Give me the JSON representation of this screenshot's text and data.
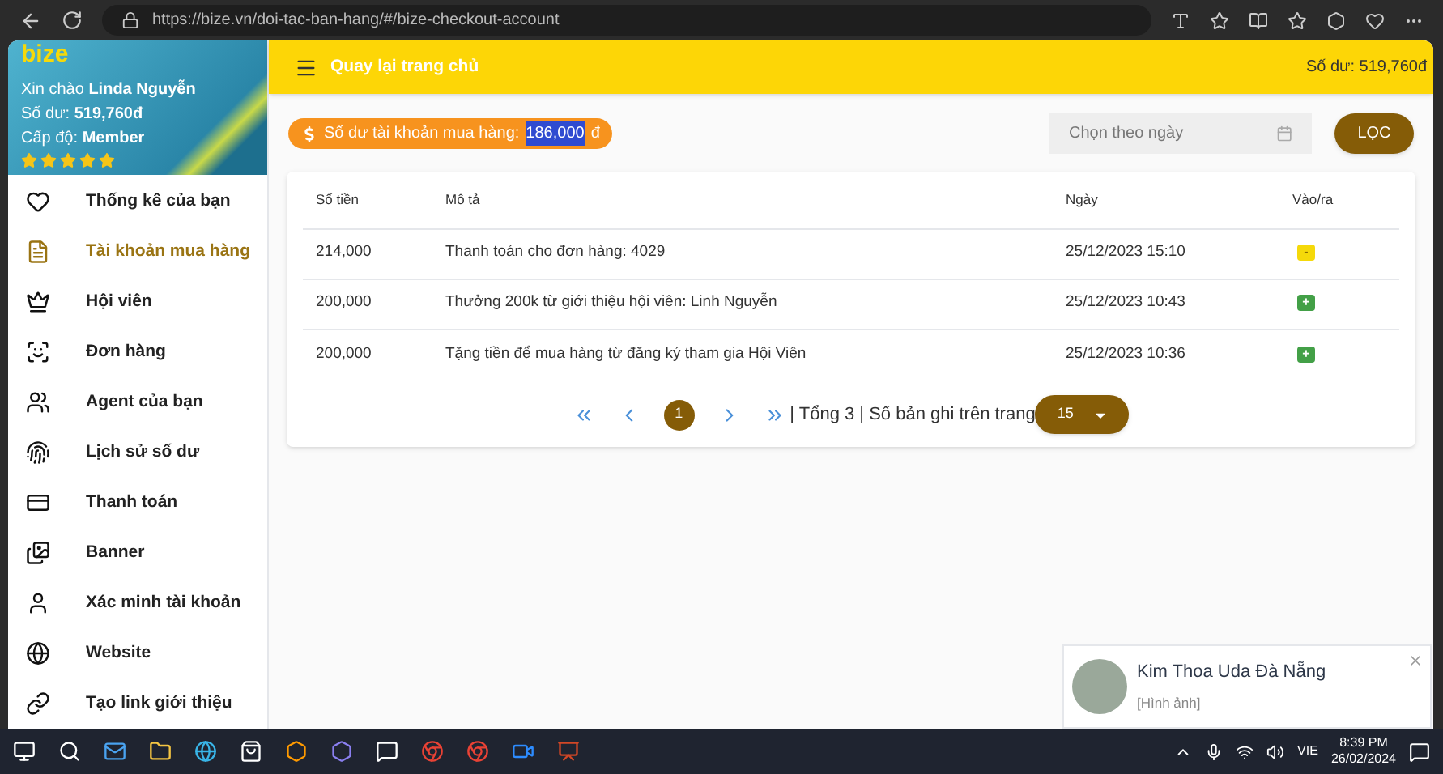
{
  "browser": {
    "url": "https://bize.vn/doi-tac-ban-hang/#/bize-checkout-account"
  },
  "sidebar": {
    "logo": "bize",
    "greeting": "Xin chào",
    "user": "Linda Nguyễn",
    "balance_label": "Số dư:",
    "balance": "519,760đ",
    "level_label": "Cấp độ:",
    "level": "Member",
    "stars": 5,
    "items": [
      {
        "label": "Thống kê của bạn",
        "selected": false
      },
      {
        "label": "Tài khoản mua hàng",
        "selected": true
      },
      {
        "label": "Hội viên",
        "selected": false
      },
      {
        "label": "Đơn hàng",
        "selected": false
      },
      {
        "label": "Agent của bạn",
        "selected": false
      },
      {
        "label": "Lịch sử số dư",
        "selected": false
      },
      {
        "label": "Thanh toán",
        "selected": false
      },
      {
        "label": "Banner",
        "selected": false
      },
      {
        "label": "Xác minh tài khoản",
        "selected": false
      },
      {
        "label": "Website",
        "selected": false
      },
      {
        "label": "Tạo link giới thiệu",
        "selected": false
      }
    ]
  },
  "header": {
    "back": "Quay lại trang chủ",
    "balance": "Số dư: 519,760đ"
  },
  "account_badge": {
    "label": "Số dư tài khoản mua hàng:",
    "amount": "186,000",
    "currency": "đ",
    "amount_selected": true
  },
  "filter": {
    "placeholder": "Chọn theo ngày",
    "button": "LỌC"
  },
  "table": {
    "columns": [
      "Số tiền",
      "Mô tả",
      "Ngày",
      "Vào/ra"
    ],
    "rows": [
      {
        "amount": "214,000",
        "description": "Thanh toán cho đơn hàng: 4029",
        "date": "25/12/2023 15:10",
        "kind": "out",
        "sign": "-"
      },
      {
        "amount": "200,000",
        "description": "Thưởng 200k từ giới thiệu hội viên: Linh Nguyễn",
        "date": "25/12/2023 10:43",
        "kind": "in",
        "sign": "+"
      },
      {
        "amount": "200,000",
        "description": "Tặng tiền để mua hàng từ đăng ký tham gia Hội Viên",
        "date": "25/12/2023 10:36",
        "kind": "in",
        "sign": "+"
      }
    ]
  },
  "pagination": {
    "pages": [
      {
        "label": "1",
        "selected": true
      }
    ],
    "summary": "| Tổng 3 | Số bản ghi trên trang",
    "page_size": "15"
  },
  "notification": {
    "name": "Kim Thoa Uda Đà Nẵng",
    "message": "[Hình ảnh]"
  },
  "taskbar": {
    "language": "VIE",
    "time": "8:39 PM",
    "date": "26/02/2024"
  }
}
